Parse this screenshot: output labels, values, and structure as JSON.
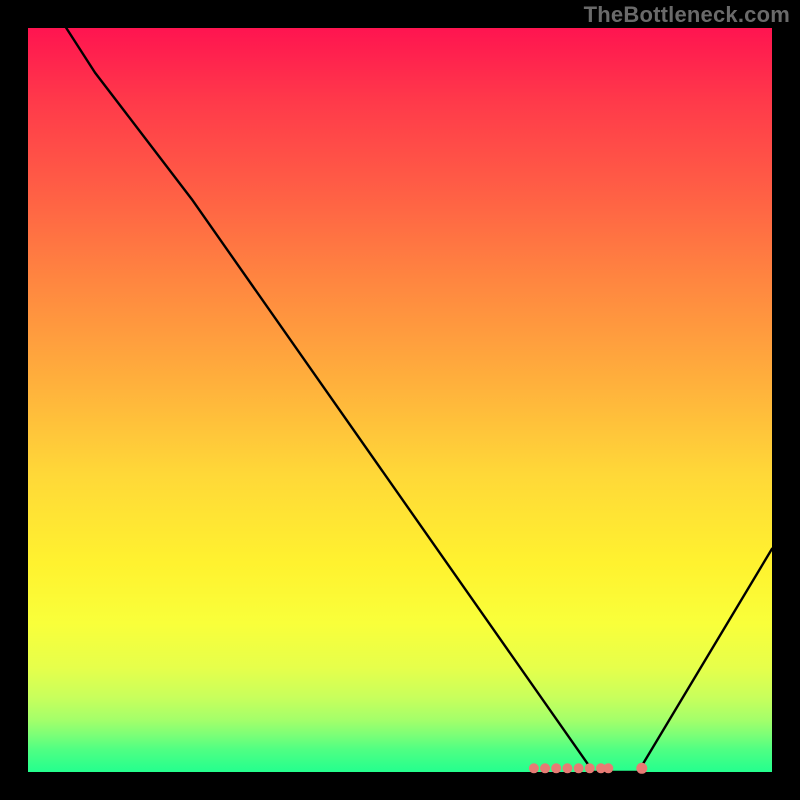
{
  "watermark": "TheBottleneck.com",
  "chart_data": {
    "type": "line",
    "title": "",
    "xlabel": "",
    "ylabel": "",
    "xlim": [
      0,
      100
    ],
    "ylim": [
      0,
      100
    ],
    "grid": false,
    "legend": false,
    "series": [
      {
        "name": "bottleneck-curve",
        "x": [
          0,
          9,
          22,
          76,
          82,
          100
        ],
        "y": [
          108,
          94,
          77,
          0,
          0,
          30
        ]
      }
    ],
    "markers": {
      "name": "optimal-range",
      "y": 0.5,
      "x": [
        68,
        69.5,
        71,
        72.5,
        74,
        75.5,
        77,
        78,
        82.5
      ]
    },
    "background_gradient": {
      "top_color": "#ff1450",
      "bottom_color": "#24ff8e"
    }
  }
}
